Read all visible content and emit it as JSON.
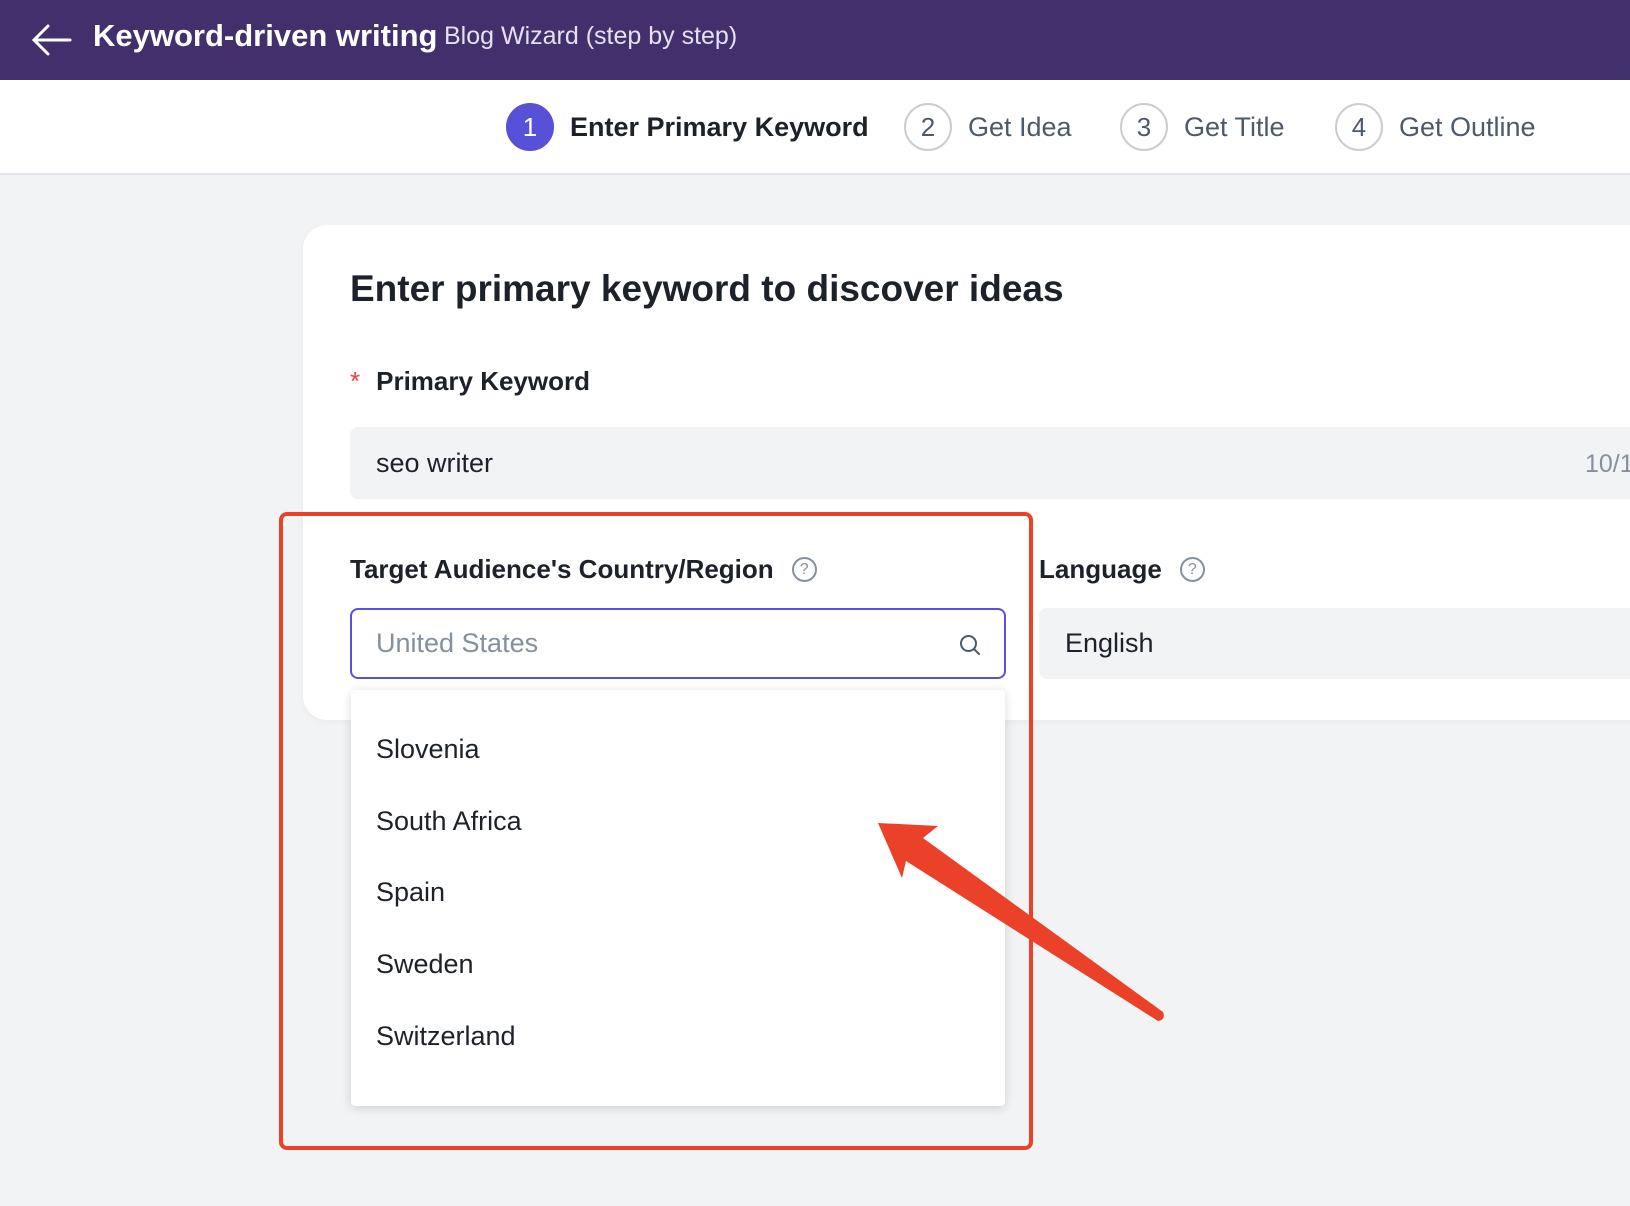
{
  "header": {
    "title": "Keyword-driven writing",
    "subtitle": "Blog Wizard (step by step)",
    "back_icon": "arrow-left-icon"
  },
  "steps": [
    {
      "number": "1",
      "label": "Enter Primary Keyword",
      "active": true
    },
    {
      "number": "2",
      "label": "Get Idea",
      "active": false
    },
    {
      "number": "3",
      "label": "Get Title",
      "active": false
    },
    {
      "number": "4",
      "label": "Get Outline",
      "active": false
    }
  ],
  "form": {
    "heading": "Enter primary keyword to discover ideas",
    "keyword_label": "Primary Keyword",
    "required_mark": "*",
    "keyword_value": "seo writer",
    "keyword_counter": "10/1",
    "country_label": "Target Audience's Country/Region",
    "country_placeholder": "United States",
    "language_label": "Language",
    "language_value": "English",
    "help_glyph": "?"
  },
  "dropdown": {
    "options": [
      "Slovenia",
      "South Africa",
      "Spain",
      "Sweden",
      "Switzerland"
    ]
  },
  "colors": {
    "header": "#41306c",
    "accent": "#5750d8",
    "annotation": "#ea4128"
  }
}
